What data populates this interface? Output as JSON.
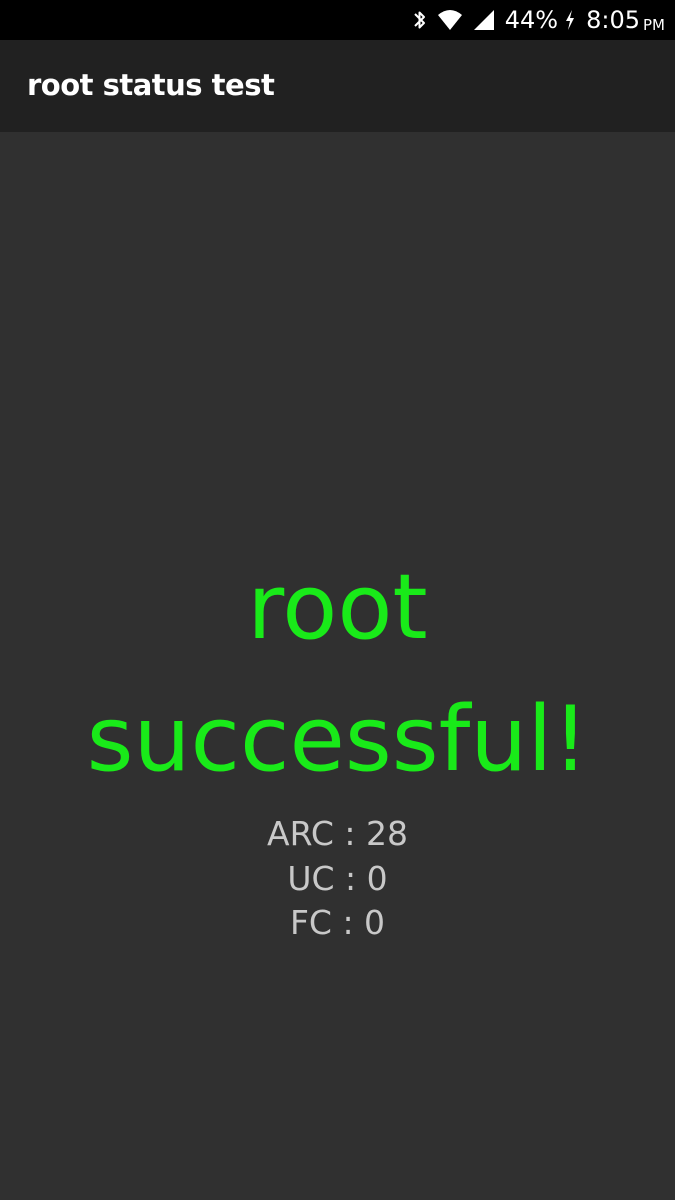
{
  "status_bar": {
    "battery_percent": "44%",
    "time": "8:05",
    "ampm": "PM",
    "icons": [
      "bluetooth-icon",
      "wifi-icon",
      "cell-signal-icon",
      "charging-icon"
    ]
  },
  "app_bar": {
    "title": "root status test"
  },
  "result": {
    "line1": "root",
    "line2": "successful!",
    "color": "#19ea19"
  },
  "stats": {
    "arc": "ARC : 28",
    "uc": "UC : 0",
    "fc": "FC : 0"
  }
}
